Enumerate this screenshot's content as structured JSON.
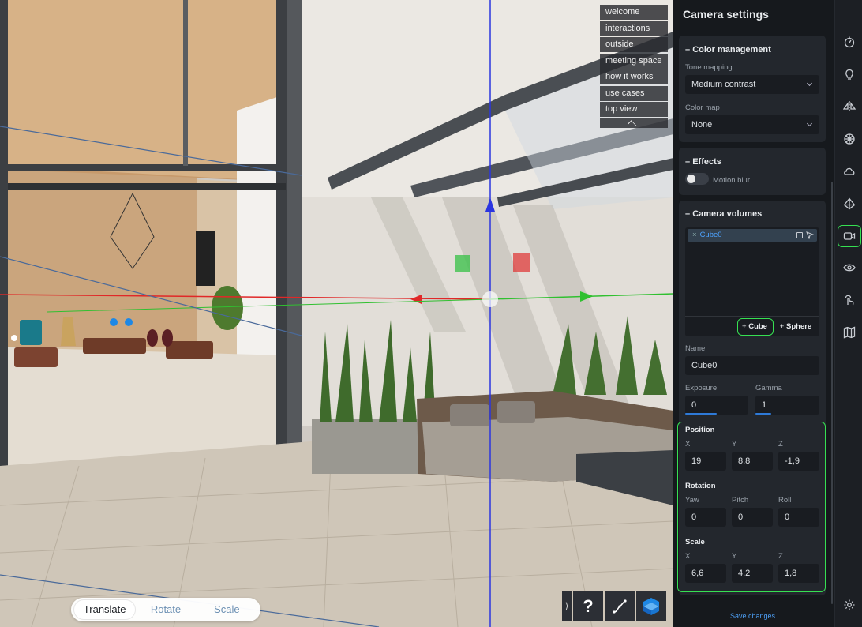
{
  "viewport": {
    "nav_items": [
      "welcome",
      "interactions",
      "outside",
      "meeting space",
      "how it works",
      "use cases",
      "top view"
    ],
    "modes": [
      "Translate",
      "Rotate",
      "Scale"
    ],
    "active_mode": "Translate",
    "tools": {
      "collapse": "⟩",
      "help": "?"
    }
  },
  "panel": {
    "title": "Camera settings",
    "color_management": {
      "header": "Color management",
      "tone_mapping_label": "Tone mapping",
      "tone_mapping_value": "Medium contrast",
      "color_map_label": "Color map",
      "color_map_value": "None"
    },
    "effects": {
      "header": "Effects",
      "motion_blur_label": "Motion blur",
      "motion_blur_on": false
    },
    "camera_volumes": {
      "header": "Camera volumes",
      "items": [
        "Cube0"
      ],
      "add_cube": "Cube",
      "add_sphere": "Sphere",
      "name_label": "Name",
      "name_value": "Cube0",
      "exposure_label": "Exposure",
      "exposure_value": "0",
      "gamma_label": "Gamma",
      "gamma_value": "1",
      "position": {
        "label": "Position",
        "x_label": "X",
        "y_label": "Y",
        "z_label": "Z",
        "x": "19",
        "y": "8,8",
        "z": "-1,9"
      },
      "rotation": {
        "label": "Rotation",
        "yaw_label": "Yaw",
        "pitch_label": "Pitch",
        "roll_label": "Roll",
        "yaw": "0",
        "pitch": "0",
        "roll": "0"
      },
      "scale": {
        "label": "Scale",
        "x_label": "X",
        "y_label": "Y",
        "z_label": "Z",
        "x": "6,6",
        "y": "4,2",
        "z": "1,8"
      }
    },
    "save_label": "Save changes"
  },
  "rail": {
    "icons": [
      "timer-icon",
      "lightbulb-icon",
      "mirror-icon",
      "material-ball-icon",
      "cloud-icon",
      "prism-icon",
      "video-camera-icon",
      "eye-icon",
      "touch-gesture-icon",
      "map-icon",
      "settings-gear-icon"
    ],
    "active": "video-camera-icon"
  },
  "colors": {
    "accent": "#36e052",
    "link": "#4d9ff5",
    "panel_bg": "#16191d"
  }
}
